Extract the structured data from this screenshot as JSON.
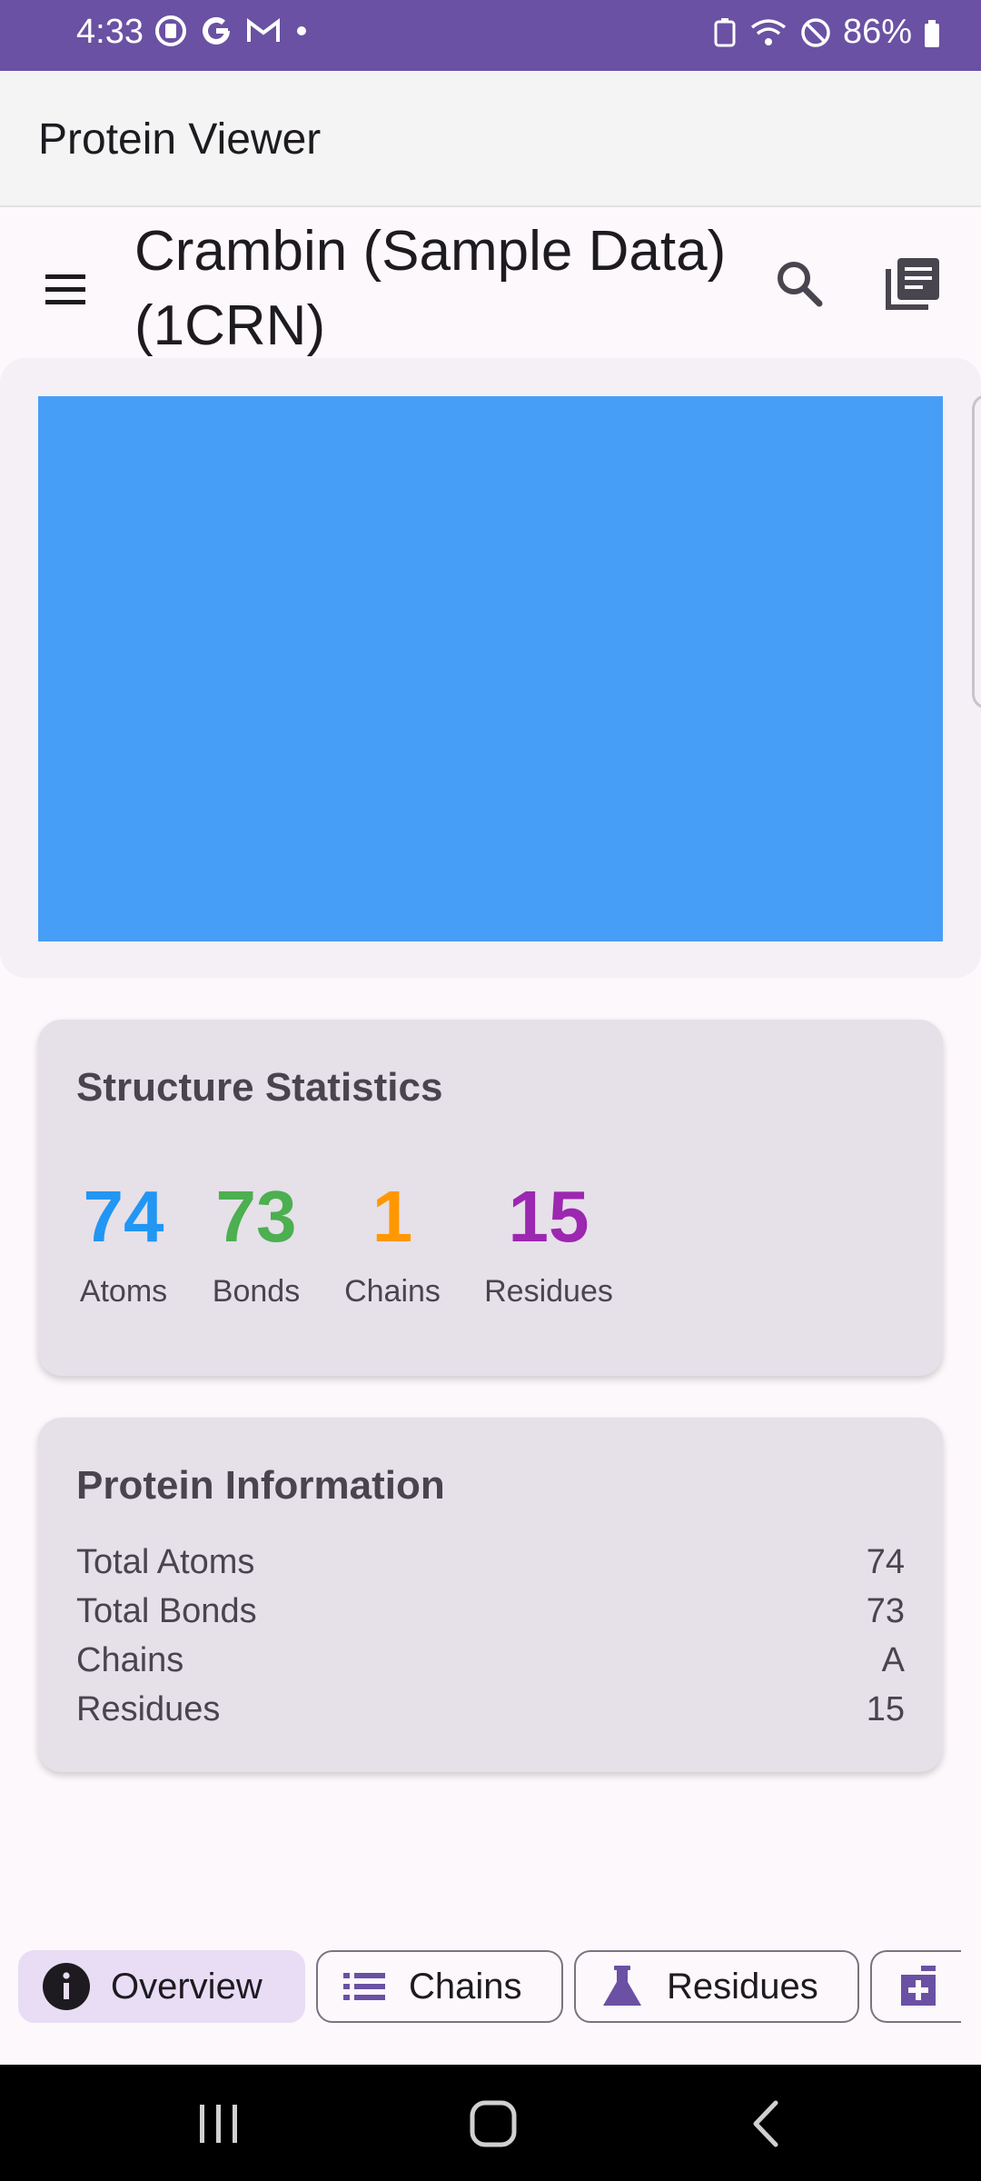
{
  "status_bar": {
    "time": "4:33",
    "battery": "86%"
  },
  "app_bar": {
    "title": "Protein Viewer"
  },
  "toolbar": {
    "title": "Crambin (Sample Data) (1CRN)"
  },
  "structure_statistics": {
    "title": "Structure Statistics",
    "stats": [
      {
        "value": "74",
        "label": "Atoms",
        "color": "#2196f3"
      },
      {
        "value": "73",
        "label": "Bonds",
        "color": "#4caf50"
      },
      {
        "value": "1",
        "label": "Chains",
        "color": "#ff9800"
      },
      {
        "value": "15",
        "label": "Residues",
        "color": "#9c27b0"
      }
    ]
  },
  "protein_information": {
    "title": "Protein Information",
    "rows": [
      {
        "key": "Total Atoms",
        "value": "74"
      },
      {
        "key": "Total Bonds",
        "value": "73"
      },
      {
        "key": "Chains",
        "value": "A"
      },
      {
        "key": "Residues",
        "value": "15"
      }
    ]
  },
  "tabs": [
    {
      "label": "Overview",
      "icon": "info-icon",
      "selected": true
    },
    {
      "label": "Chains",
      "icon": "list-icon",
      "selected": false
    },
    {
      "label": "Residues",
      "icon": "flask-icon",
      "selected": false
    },
    {
      "label": "",
      "icon": "medical-box-icon",
      "selected": false
    }
  ],
  "colors": {
    "status_bar": "#6a51a3",
    "viewer": "#479ef7",
    "card": "#e6e0e9",
    "selected_tab": "#e8ddf5"
  }
}
